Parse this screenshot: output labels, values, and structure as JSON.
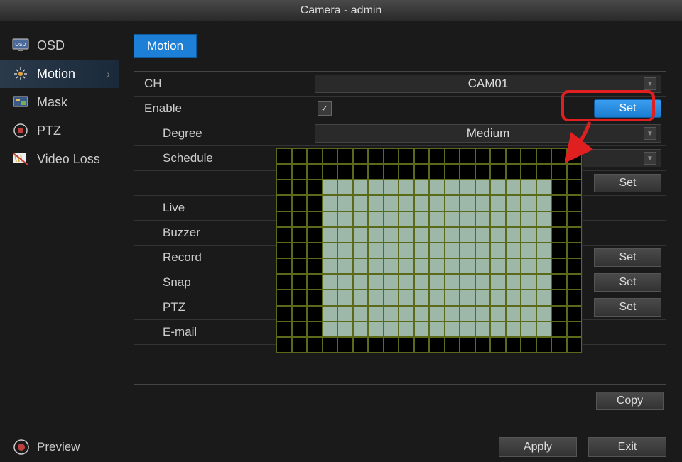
{
  "title": "Camera - admin",
  "sidebar": {
    "items": [
      {
        "label": "OSD"
      },
      {
        "label": "Motion"
      },
      {
        "label": "Mask"
      },
      {
        "label": "PTZ"
      },
      {
        "label": "Video Loss"
      }
    ]
  },
  "tab": "Motion",
  "rows": {
    "ch_label": "CH",
    "ch_value": "CAM01",
    "enable_label": "Enable",
    "enable_checked": true,
    "enable_set": "Set",
    "degree_label": "Degree",
    "degree_value": "Medium",
    "schedule_label": "Schedule",
    "schedule_set": "Set",
    "live_label": "Live",
    "buzzer_label": "Buzzer",
    "record_label": "Record",
    "record_set": "Set",
    "snap_label": "Snap",
    "snap_set": "Set",
    "ptz_label": "PTZ",
    "ptz_set": "Set",
    "email_label": "E-mail"
  },
  "copy_label": "Copy",
  "preview_label": "Preview",
  "apply_label": "Apply",
  "exit_label": "Exit",
  "grid": {
    "cols": 20,
    "rows": 13,
    "sel_col_start": 3,
    "sel_col_end": 17,
    "sel_row_start": 2,
    "sel_row_end": 11
  }
}
